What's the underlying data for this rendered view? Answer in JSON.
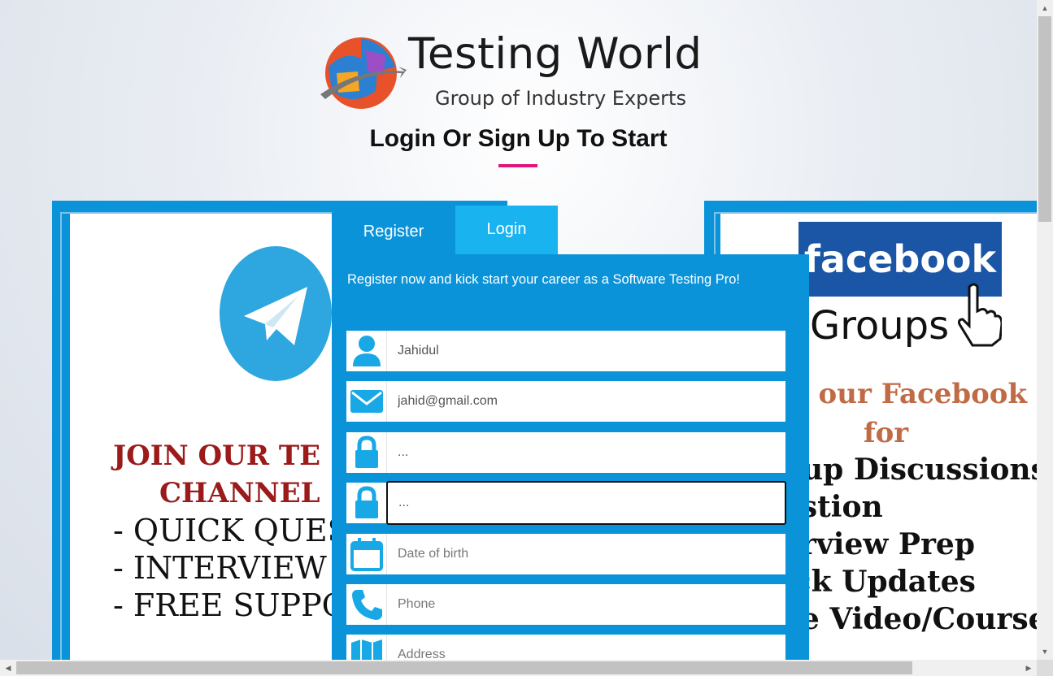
{
  "brand": {
    "title": "Testing World",
    "subtitle": "Group of Industry Experts"
  },
  "heading": "Login Or Sign Up To Start",
  "accent_color": "#e0167a",
  "panel_color": "#0a93d8",
  "tabs": {
    "register": "Register",
    "login": "Login"
  },
  "form": {
    "intro": "Register now and kick start your career as a Software Testing Pro!",
    "fields": [
      {
        "icon": "user-icon",
        "value": "Jahidul",
        "placeholder": ""
      },
      {
        "icon": "email-icon",
        "value": "jahid@gmail.com",
        "placeholder": ""
      },
      {
        "icon": "lock-icon",
        "value": "...",
        "placeholder": ""
      },
      {
        "icon": "lock-icon",
        "value": "...",
        "placeholder": ""
      },
      {
        "icon": "calendar-icon",
        "value": "",
        "placeholder": "Date of birth"
      },
      {
        "icon": "phone-icon",
        "value": "",
        "placeholder": "Phone"
      },
      {
        "icon": "map-icon",
        "value": "",
        "placeholder": "Address"
      }
    ]
  },
  "telegram_promo": {
    "line1": "JOIN OUR TE",
    "line2": "CHANNEL",
    "items": [
      "- QUICK QUES",
      "- INTERVIEW",
      "- FREE SUPPO"
    ]
  },
  "facebook_promo": {
    "logo": "facebook",
    "groups": "Groups",
    "line1": "n our Facebook G",
    "line2": "for",
    "items": [
      "oup Discussions",
      "estion",
      "erview Prep",
      "ick Updates",
      "ee Video/Course"
    ]
  }
}
